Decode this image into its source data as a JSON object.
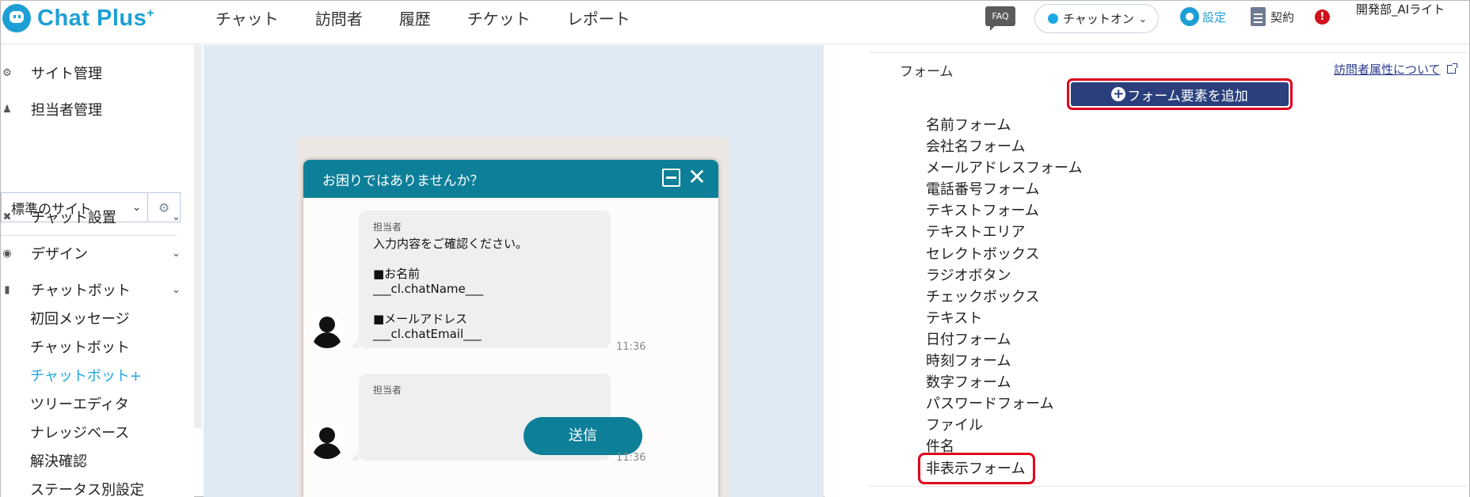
{
  "header": {
    "logo_text": "Chat Plus",
    "logo_sup": "+",
    "nav": [
      "チャット",
      "訪問者",
      "履歴",
      "チケット",
      "レポート"
    ],
    "faq_label": "FAQ",
    "chat_status": "チャットオン",
    "settings_label": "設定",
    "contract_label": "契約",
    "alert_symbol": "!",
    "user_name": "開発部_AIライト"
  },
  "sidebar": {
    "site_management": "サイト管理",
    "staff_management": "担当者管理",
    "site_select_value": "標準のサイト",
    "sections": [
      "チャット設置",
      "デザイン",
      "チャットボット"
    ],
    "bot_subitems": [
      "初回メッセージ",
      "チャットボット",
      "チャットボット+",
      "ツリーエディタ",
      "ナレッジベース",
      "解決確認",
      "ステータス別設定"
    ],
    "active_subitem_index": 2
  },
  "widget": {
    "title": "お困りではありませんか？",
    "message1": {
      "sender": "担当者",
      "lines": [
        "入力内容をご確認ください。",
        "",
        "■お名前",
        "___cl.chatName___",
        "",
        "■メールアドレス",
        "___cl.chatEmail___"
      ],
      "time": "11:36"
    },
    "message2": {
      "sender": "担当者",
      "button_label": "送信",
      "time": "11:36"
    }
  },
  "form_panel": {
    "label": "フォーム",
    "attr_link": "訪問者属性について",
    "add_button": "フォーム要素を追加",
    "items": [
      "名前フォーム",
      "会社名フォーム",
      "メールアドレスフォーム",
      "電話番号フォーム",
      "テキストフォーム",
      "テキストエリア",
      "セレクトボックス",
      "ラジオボタン",
      "チェックボックス",
      "テキスト",
      "日付フォーム",
      "時刻フォーム",
      "数字フォーム",
      "パスワードフォーム",
      "ファイル",
      "件名",
      "非表示フォーム"
    ],
    "highlighted_item": "非表示フォーム"
  },
  "colors": {
    "brand": "#1d9fd5",
    "widget_header": "#0e7f98",
    "add_button_bg": "#2a3f7c",
    "highlight": "#e0001b",
    "active_link": "#1da8e2"
  }
}
